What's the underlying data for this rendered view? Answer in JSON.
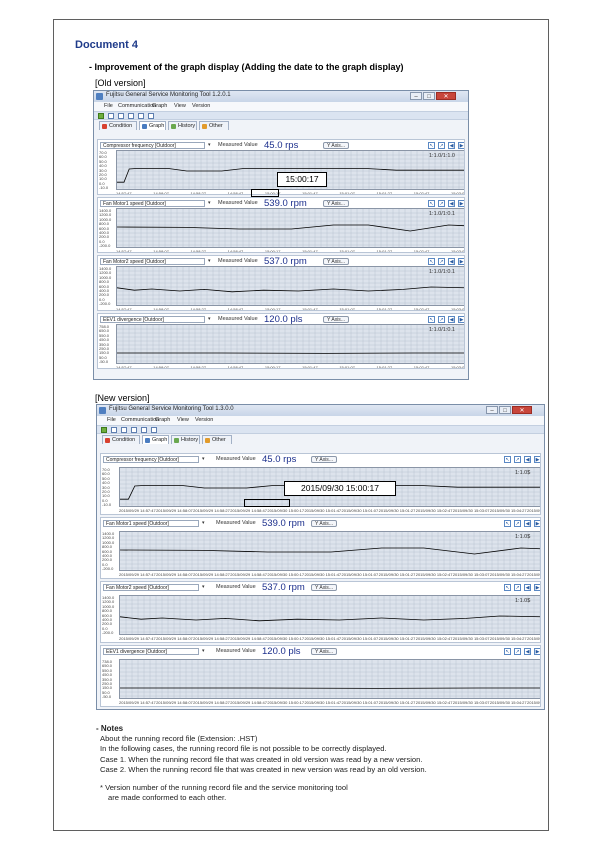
{
  "document_title": "Document 4",
  "section_heading": "- Improvement of the graph display (Adding the date to the graph display)",
  "old_label": "[Old version]",
  "new_label": "[New version]",
  "old_window": {
    "title": "Fujitsu General Service Monitoring Tool 1.2.0.1",
    "menu": [
      "File",
      "Communication",
      "Graph",
      "View",
      "Version"
    ],
    "tabs": [
      "Condition",
      "Graph",
      "History",
      "Other"
    ],
    "measured_label": "Measured Value",
    "axis_button": "Y Axis...",
    "nav": [
      "↖",
      "↗",
      "◀",
      "▶"
    ],
    "callout": "15:00:17",
    "channels": [
      {
        "name": "Compressor frequency [Outdoor]",
        "value": "45.0 rps",
        "ratio": "1:1.0/1:1.0",
        "yticks": [
          "70.0",
          "60.0",
          "50.0",
          "40.0",
          "30.0",
          "20.0",
          "10.0",
          "0.0",
          "-10.0"
        ]
      },
      {
        "name": "Fan Motor1 speed [Outdoor]",
        "value": "539.0 rpm",
        "ratio": "1:1.0/1:0.1",
        "yticks": [
          "1400.0",
          "1200.0",
          "1000.0",
          "800.0",
          "600.0",
          "400.0",
          "200.0",
          "0.0",
          "-200.0"
        ]
      },
      {
        "name": "Fan Motor2 speed [Outdoor]",
        "value": "537.0 rpm",
        "ratio": "1:1.0/1:0.1",
        "yticks": [
          "1400.0",
          "1200.0",
          "1000.0",
          "800.0",
          "600.0",
          "400.0",
          "200.0",
          "0.0",
          "-200.0"
        ]
      },
      {
        "name": "EEV1 divergence [Outdoor]",
        "value": "120.0 pls",
        "ratio": "1:1.0/1:0.1",
        "yticks": [
          "758.0",
          "650.0",
          "550.0",
          "450.0",
          "350.0",
          "250.0",
          "150.0",
          "50.0",
          "-50.0"
        ]
      }
    ],
    "xticks": [
      "14:57:47",
      "14:58:07",
      "14:58:27",
      "14:58:47",
      "15:00:17",
      "15:01:47",
      "15:01:07",
      "15:01:27",
      "15:02:47",
      "15:03:07"
    ]
  },
  "new_window": {
    "title": "Fujitsu General Service Monitoring Tool 1.3.0.0",
    "menu": [
      "File",
      "Communication",
      "Graph",
      "View",
      "Version"
    ],
    "tabs": [
      "Condition",
      "Graph",
      "History",
      "Other"
    ],
    "measured_label": "Measured Value",
    "axis_button": "Y Axis...",
    "nav": [
      "↖",
      "↗",
      "◀",
      "▶"
    ],
    "callout": "2015/09/30 15:00:17",
    "channels": [
      {
        "name": "Compressor frequency [Outdoor]",
        "value": "45.0 rps",
        "ratio": "1:1.0$",
        "yticks": [
          "70.0",
          "60.0",
          "50.0",
          "40.0",
          "30.0",
          "20.0",
          "10.0",
          "0.0",
          "-10.0"
        ]
      },
      {
        "name": "Fan Motor1 speed [Outdoor]",
        "value": "539.0 rpm",
        "ratio": "1:1.0$",
        "yticks": [
          "1400.0",
          "1200.0",
          "1000.0",
          "800.0",
          "600.0",
          "400.0",
          "200.0",
          "0.0",
          "-200.0"
        ]
      },
      {
        "name": "Fan Motor2 speed [Outdoor]",
        "value": "537.0 rpm",
        "ratio": "1:1.0$",
        "yticks": [
          "1400.0",
          "1200.0",
          "1000.0",
          "800.0",
          "600.0",
          "400.0",
          "200.0",
          "0.0",
          "-200.0"
        ]
      },
      {
        "name": "EEV1 divergence [Outdoor]",
        "value": "120.0 pls",
        "ratio": "",
        "yticks": [
          "738.0",
          "650.0",
          "550.0",
          "450.0",
          "350.0",
          "250.0",
          "150.0",
          "50.0",
          "-50.0"
        ]
      }
    ],
    "xticks": [
      "2015/09/29 14:57:47",
      "2015/09/29 14:58:07",
      "2015/09/29 14:58:27",
      "2015/09/29 14:58:47",
      "2015/09/30 15:00:17",
      "2015/09/30 15:01:47",
      "2015/09/30 15:01:07",
      "2015/09/30 15:01:27",
      "2015/09/30 15:02:47",
      "2015/09/30 15:03:07",
      "2015/09/30 15:04:27",
      "2015/09/30 15:04:47"
    ]
  },
  "notes": {
    "heading": "- Notes",
    "lines": [
      "About the running record file (Extension: .HST)",
      "In the following cases, the running record file is not possible to be correctly displayed.",
      "Case 1. When the running record file that was created in old version was read by a new version.",
      "Case 2. When the running record file that was created in new version was read by an old version."
    ],
    "footnote_1": "* Version number of the running record file and the service monitoring tool",
    "footnote_2": "are made conformed to each other."
  },
  "colors": {
    "title": "#1f3b8a",
    "value": "#1b2e8c",
    "plot_bg": "#dde3ec",
    "trace": "#000000"
  }
}
